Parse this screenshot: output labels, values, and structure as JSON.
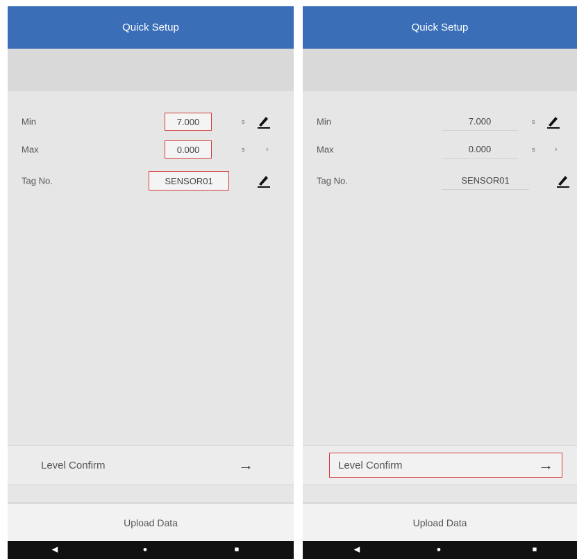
{
  "left": {
    "header_title": "Quick Setup",
    "rows": [
      {
        "label": "Min",
        "value": "7.000",
        "unit": "s",
        "action": "pencil"
      },
      {
        "label": "Max",
        "value": "0.000",
        "unit": "s",
        "action": "chevron"
      },
      {
        "label": "Tag No.",
        "value": "SENSOR01",
        "action": "pencil"
      }
    ],
    "level_confirm": "Level Confirm",
    "upload_data": "Upload Data"
  },
  "right": {
    "header_title": "Quick Setup",
    "rows": [
      {
        "label": "Min",
        "value": "7.000",
        "unit": "s",
        "action": "pencil"
      },
      {
        "label": "Max",
        "value": "0.000",
        "unit": "s",
        "action": "chevron"
      },
      {
        "label": "Tag No.",
        "value": "SENSOR01",
        "action": "pencil"
      }
    ],
    "level_confirm": "Level Confirm",
    "upload_data": "Upload Data"
  },
  "icons": {
    "arrow": "→",
    "chevron": "›",
    "nav_back": "◀",
    "nav_home": "●",
    "nav_recent": "■"
  },
  "colors": {
    "header_bg": "#3a6fb8",
    "highlight_border": "#d43c3c",
    "screen_bg": "#e6e6e6",
    "navbar_bg": "#111111"
  }
}
